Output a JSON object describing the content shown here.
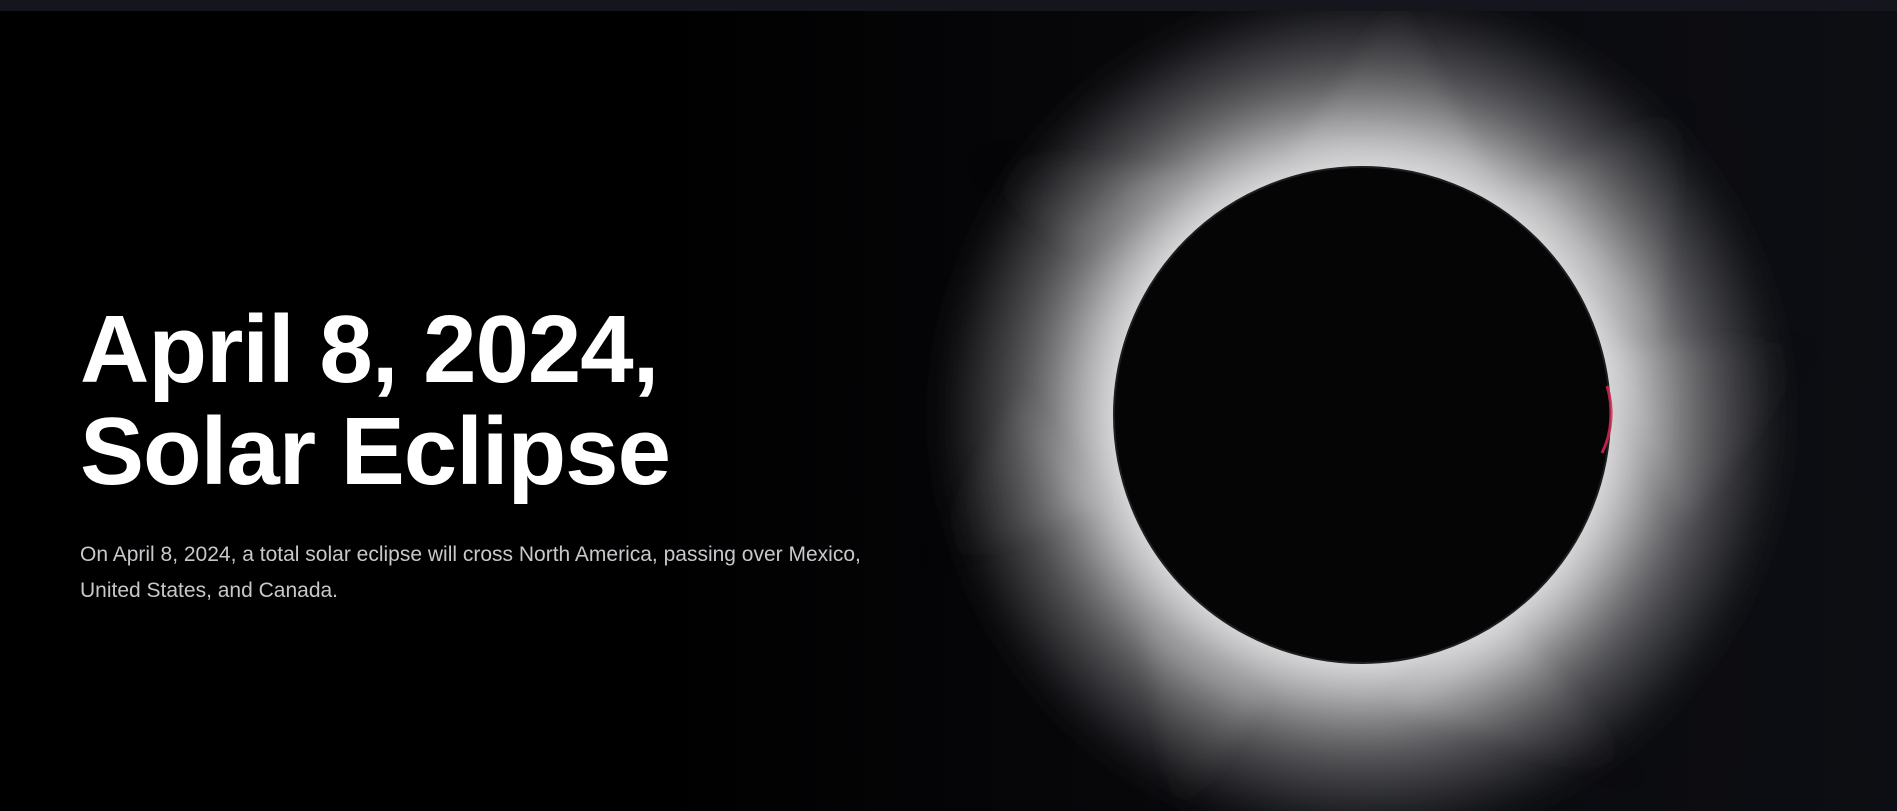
{
  "topbar": {},
  "hero": {
    "title_line1": "April 8, 2024,",
    "title_line2": "Solar Eclipse",
    "description": "On April 8, 2024, a total solar eclipse will cross North America, passing over Mexico, United States, and Canada.",
    "image": {
      "icon": "solar-eclipse-image",
      "corona_color": "#e8e8e8",
      "moon_color": "#050506",
      "prominence_color": "#d22a55"
    }
  }
}
